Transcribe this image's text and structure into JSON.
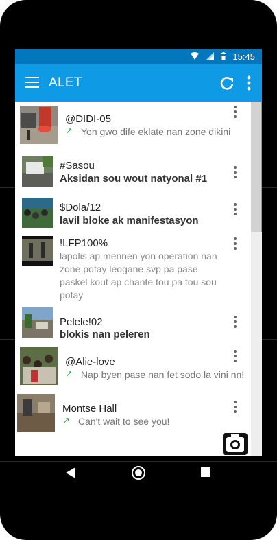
{
  "status_bar": {
    "time": "15:45",
    "icons": [
      "wifi-icon",
      "signal-icon",
      "battery-icon"
    ]
  },
  "app_bar": {
    "title": "ALET",
    "actions": [
      "refresh-icon",
      "overflow-menu-icon"
    ]
  },
  "feed": [
    {
      "handle": "@DIDI-05",
      "text": "Yon gwo dife eklate nan zone dikini",
      "style": "reply"
    },
    {
      "handle": "#Sasou",
      "text": "Aksidan sou wout natyonal #1",
      "style": "bold"
    },
    {
      "handle": "$Dola/12",
      "text": "lavil bloke ak manifestasyon",
      "style": "bold"
    },
    {
      "handle": "!LFP100%",
      "lines": [
        "lapolis ap mennen yon operation nan",
        "zone potay leogane svp pa pase",
        "paskel kout ap chante tou pa tou sou",
        "potay"
      ],
      "style": "long"
    },
    {
      "handle": "Pelele!02",
      "text": "blokis nan peleren",
      "style": "bold"
    },
    {
      "handle": "@Alie-love",
      "text": "Nap byen pase nan fet sodo la vini nn!",
      "style": "reply"
    },
    {
      "handle": "Montse Hall",
      "text": "Can't wait to see you!",
      "style": "reply"
    }
  ],
  "fab": {
    "icon": "camera-icon"
  },
  "nav_bar": {
    "icons": [
      "back-icon",
      "home-icon",
      "recents-icon"
    ]
  },
  "colors": {
    "status_bar": "#0277bd",
    "app_bar": "#0f9ae6",
    "reply_arrow": "#27a34a"
  }
}
